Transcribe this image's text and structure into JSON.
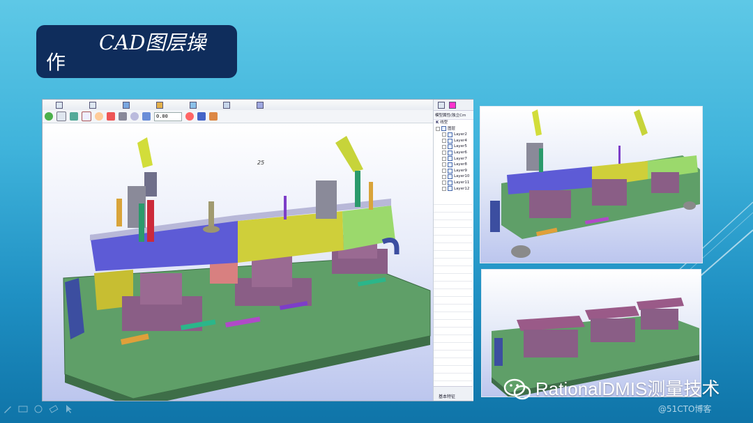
{
  "slide": {
    "title_line1": "CAD图层操",
    "title_line2": "作",
    "brand_text": "RationalDMIS测量技术",
    "credit_text": "@51CTO博客"
  },
  "toolbar": {
    "zoom_value": "0.00"
  },
  "viewport": {
    "marker_text": "25"
  },
  "side_panel": {
    "header": "模型属性(独立Cm",
    "root_label": "线型",
    "group_label": "图层",
    "layers": [
      "Layer2",
      "Layer4",
      "Layer5",
      "Layer6",
      "Layer7",
      "Layer8",
      "Layer9",
      "Layer10",
      "Layer11",
      "Layer12"
    ],
    "footer_tab": "基本特征"
  },
  "icons": [
    "new-doc-icon",
    "save-icon",
    "measure-icon",
    "probe-icon",
    "view-icon",
    "report-icon",
    "refresh-icon",
    "fit-icon",
    "rotate-icon",
    "axis-icon",
    "eye-icon",
    "palette-icon",
    "camera-icon",
    "zoom-icon",
    "wechat-icon",
    "pen-icon",
    "slide-icon",
    "eraser-icon",
    "pointer-icon"
  ],
  "colors": {
    "title_bg": "#0f2d5c",
    "accent_blue": "#5d5bd6",
    "fixture_base": "#5e9e6a",
    "support_pink": "#9a5a7d"
  }
}
